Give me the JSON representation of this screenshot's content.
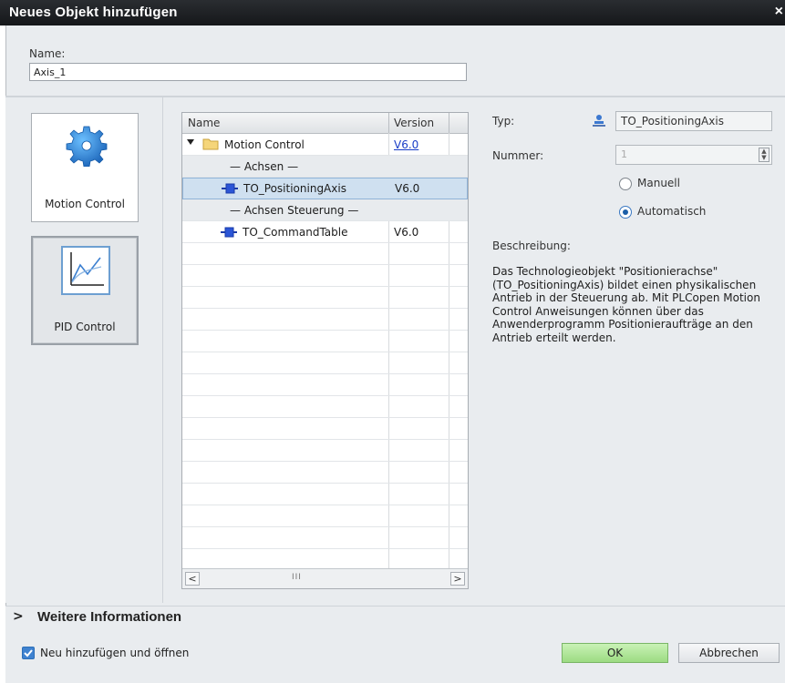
{
  "window": {
    "title": "Neues Objekt hinzufügen",
    "close_glyph": "×"
  },
  "name_field": {
    "label": "Name:",
    "value": "Axis_1"
  },
  "categories": [
    {
      "label": "Motion Control",
      "icon": "gear-icon"
    },
    {
      "label": "PID Control",
      "icon": "pid-chart-icon"
    }
  ],
  "tree": {
    "headers": {
      "name": "Name",
      "version": "Version"
    },
    "rows": [
      {
        "name": "Motion Control",
        "version": "V6.0"
      },
      {
        "name": "— Achsen —",
        "version": ""
      },
      {
        "name": "TO_PositioningAxis",
        "version": "V6.0"
      },
      {
        "name": "— Achsen Steuerung —",
        "version": ""
      },
      {
        "name": "TO_CommandTable",
        "version": "V6.0"
      }
    ],
    "scroll_thumb": "III",
    "scroll_left": "<",
    "scroll_right": ">"
  },
  "details": {
    "typ_label": "Typ:",
    "typ_value": "TO_PositioningAxis",
    "nummer_label": "Nummer:",
    "nummer_value": "1",
    "radio_manuell": "Manuell",
    "radio_automatisch": "Automatisch",
    "selected_radio": "Automatisch",
    "beschreibung_label": "Beschreibung:",
    "beschreibung_text": "Das Technologieobjekt \"Positionierachse\" (TO_PositioningAxis) bildet einen physikalischen Antrieb in der Steuerung ab. Mit PLCopen Motion Control Anweisungen können über das Anwenderprogramm Positionieraufträge an den Antrieb erteilt werden."
  },
  "more_info": {
    "chevron": ">",
    "label": "Weitere Informationen"
  },
  "footer": {
    "checkbox_label": "Neu hinzufügen und öffnen",
    "checkbox_checked": true,
    "ok_label": "OK",
    "cancel_label": "Abbrechen"
  },
  "colors": {
    "titlebar": "#1f2226",
    "ok_button": "#b4e89c",
    "selected_row": "#cfe0f0",
    "link": "#1a3ec7",
    "gear": "#2f86d6"
  }
}
